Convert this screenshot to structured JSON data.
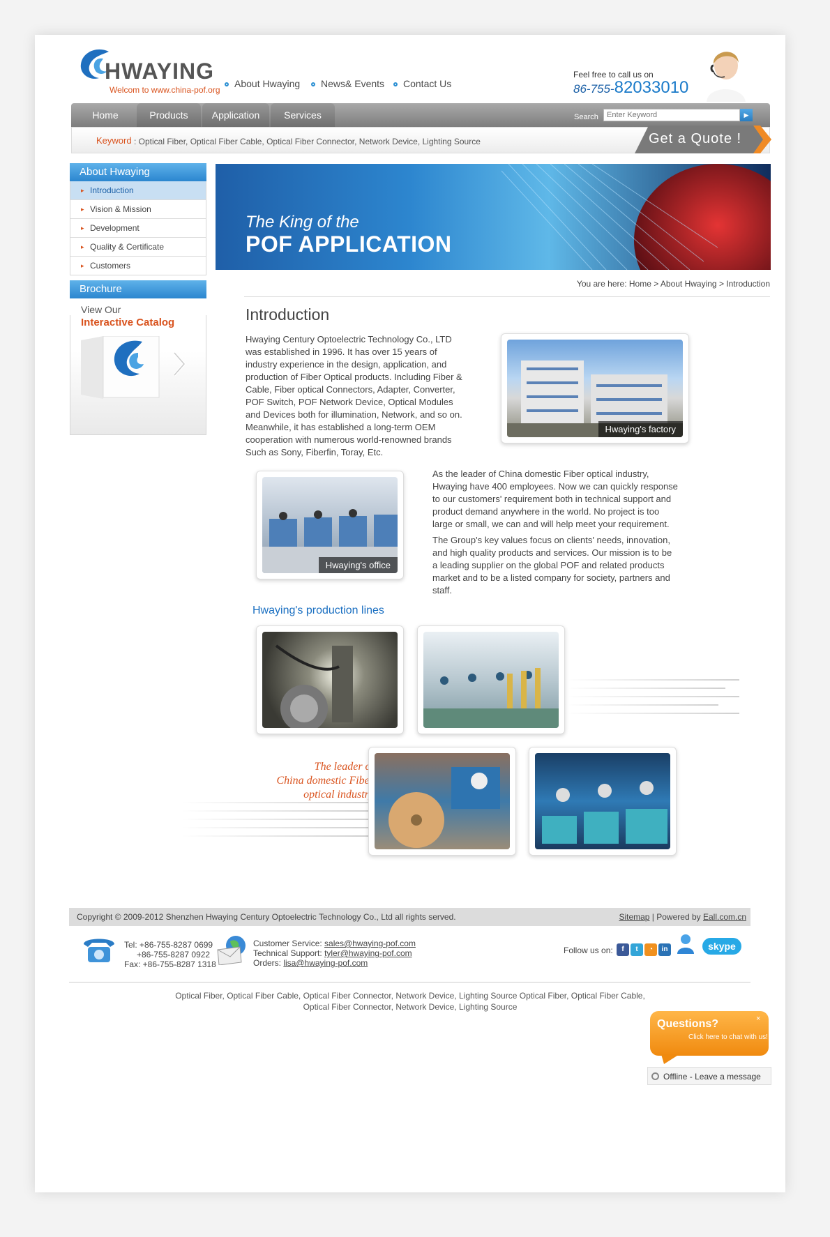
{
  "header": {
    "logo_text": "HWAYING",
    "tagline": "Welcom to www.china-pof.org",
    "top_nav": [
      "About Hwaying",
      "News& Events",
      "Contact Us"
    ],
    "call_label": "Feel free to call us on",
    "call_prefix": "86-755-",
    "call_number": "82033010"
  },
  "nav": {
    "tabs": [
      "Home",
      "Products",
      "Application",
      "Services"
    ],
    "search_label": "Search",
    "search_placeholder": "Enter Keyword"
  },
  "keywords": {
    "label": "Keyword",
    "text": ": Optical Fiber,  Optical Fiber Cable, Optical Fiber Connector, Network Device, Lighting Source"
  },
  "quote_button": "Get a Quote !",
  "sidebar": {
    "title": "About Hwaying",
    "items": [
      {
        "label": "Introduction"
      },
      {
        "label": "Vision & Mission"
      },
      {
        "label": "Development"
      },
      {
        "label": "Quality & Certificate"
      },
      {
        "label": "Customers"
      }
    ],
    "brochure_title": "Brochure",
    "brochure_view": "View Our",
    "brochure_catalog": "Interactive Catalog"
  },
  "banner": {
    "line1": "The King of the",
    "line2": "POF APPLICATION"
  },
  "breadcrumb": "You are here: Home > About Hwaying > Introduction",
  "main": {
    "title": "Introduction",
    "para1": "Hwaying Century Optoelectric Technology Co., LTD was established in 1996. It has over 15 years of industry experience in the design, application, and production of Fiber Optical products. Including Fiber & Cable, Fiber optical Connectors, Adapter, Converter, POF Switch, POF Network Device, Optical Modules and Devices both for illumination, Network, and so on. Meanwhile, it has established a long-term OEM cooperation with numerous world-renowned brands Such as Sony, Fiberfin, Toray, Etc.",
    "factory_caption": "Hwaying's factory",
    "office_caption": "Hwaying's office",
    "para2": "As the leader of China domestic Fiber optical industry, Hwaying have 400 employees. Now we can quickly response to our customers' requirement both in technical support and product demand anywhere in the world. No project is too large or small, we can and will help meet your requirement.",
    "para3": "The Group's key values focus on clients' needs, innovation, and high quality products and services. Our mission is to be a leading supplier on the global POF and related products market and to be a listed company for society, partners and staff.",
    "production_title": "Hwaying's production lines",
    "leader_text": [
      "The leader of",
      "China domestic Fiber",
      "optical industry"
    ]
  },
  "footer": {
    "copyright": "Copyright © 2009-2012 Shenzhen Hwaying Century Optoelectric Technology Co., Ltd all rights served.",
    "sitemap": "Sitemap",
    "powered_prefix": " | Powered by ",
    "powered_link": "Eall.com.cn",
    "tel": "Tel: +86-755-8287 0699",
    "tel2": "+86-755-8287 0922",
    "fax": "Fax: +86-755-8287 1318",
    "cs_label": "Customer Service: ",
    "cs_email": "sales@hwaying-pof.com",
    "ts_label": "Technical Support: ",
    "ts_email": "tyler@hwaying-pof.com",
    "orders_label": "Orders: ",
    "orders_email": "lisa@hwaying-pof.com",
    "follow": "Follow us on:",
    "keywords_line1": "Optical Fiber,  Optical Fiber Cable, Optical Fiber Connector, Network Device, Lighting Source Optical Fiber,  Optical Fiber Cable,",
    "keywords_line2": "Optical Fiber Connector, Network Device, Lighting Source"
  },
  "chat": {
    "title": "Questions?",
    "subtitle": "Click here to chat with us!",
    "status": "Offline - Leave a message",
    "close": "×"
  },
  "colors": {
    "accent_blue": "#2b86cf",
    "accent_orange": "#d9531e",
    "nav_gray": "#8a8a8a"
  }
}
